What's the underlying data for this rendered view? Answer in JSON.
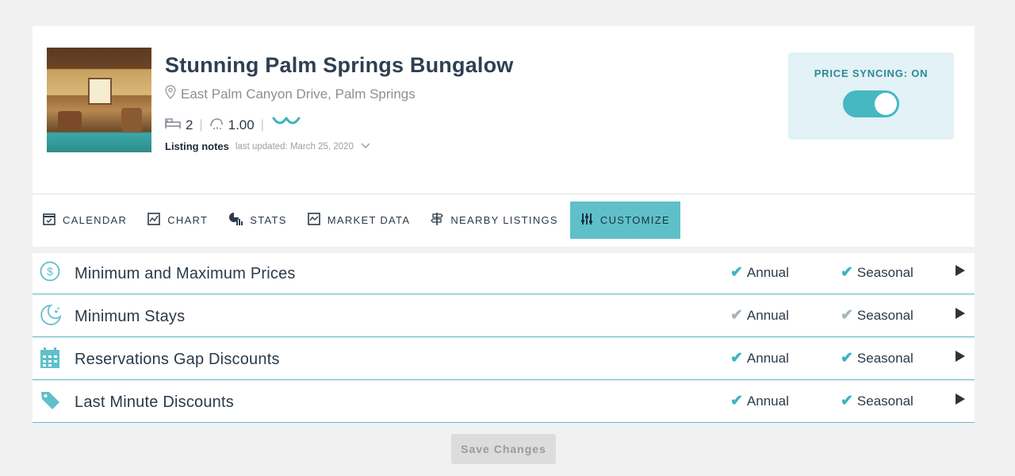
{
  "listing": {
    "title": "Stunning Palm Springs Bungalow",
    "address": "East Palm Canyon Drive, Palm Springs",
    "bedrooms": "2",
    "bathrooms": "1.00",
    "notes_label": "Listing notes",
    "notes_updated": "last updated: March 25, 2020"
  },
  "sync": {
    "label": "PRICE SYNCING: ON",
    "enabled": true
  },
  "tabs": [
    {
      "label": "CALENDAR",
      "icon": "calendar-icon"
    },
    {
      "label": "CHART",
      "icon": "chart-icon"
    },
    {
      "label": "STATS",
      "icon": "stats-icon"
    },
    {
      "label": "MARKET DATA",
      "icon": "market-data-icon"
    },
    {
      "label": "NEARBY LISTINGS",
      "icon": "signpost-icon"
    },
    {
      "label": "CUSTOMIZE",
      "icon": "sliders-icon",
      "active": true
    }
  ],
  "rows": [
    {
      "label": "Minimum and Maximum Prices",
      "icon": "dollar-circle-icon",
      "annual": "Annual",
      "seasonal": "Seasonal",
      "annual_on": true,
      "seasonal_on": true
    },
    {
      "label": "Minimum Stays",
      "icon": "moon-stars-icon",
      "annual": "Annual",
      "seasonal": "Seasonal",
      "annual_on": false,
      "seasonal_on": false
    },
    {
      "label": "Reservations Gap Discounts",
      "icon": "calendar-grid-icon",
      "annual": "Annual",
      "seasonal": "Seasonal",
      "annual_on": true,
      "seasonal_on": true
    },
    {
      "label": "Last Minute Discounts",
      "icon": "price-tag-icon",
      "annual": "Annual",
      "seasonal": "Seasonal",
      "annual_on": true,
      "seasonal_on": true
    }
  ],
  "save_label": "Save Changes",
  "colors": {
    "accent": "#5fc0c9",
    "check_on": "#3eb4c0",
    "check_off": "#a6b5bd"
  }
}
